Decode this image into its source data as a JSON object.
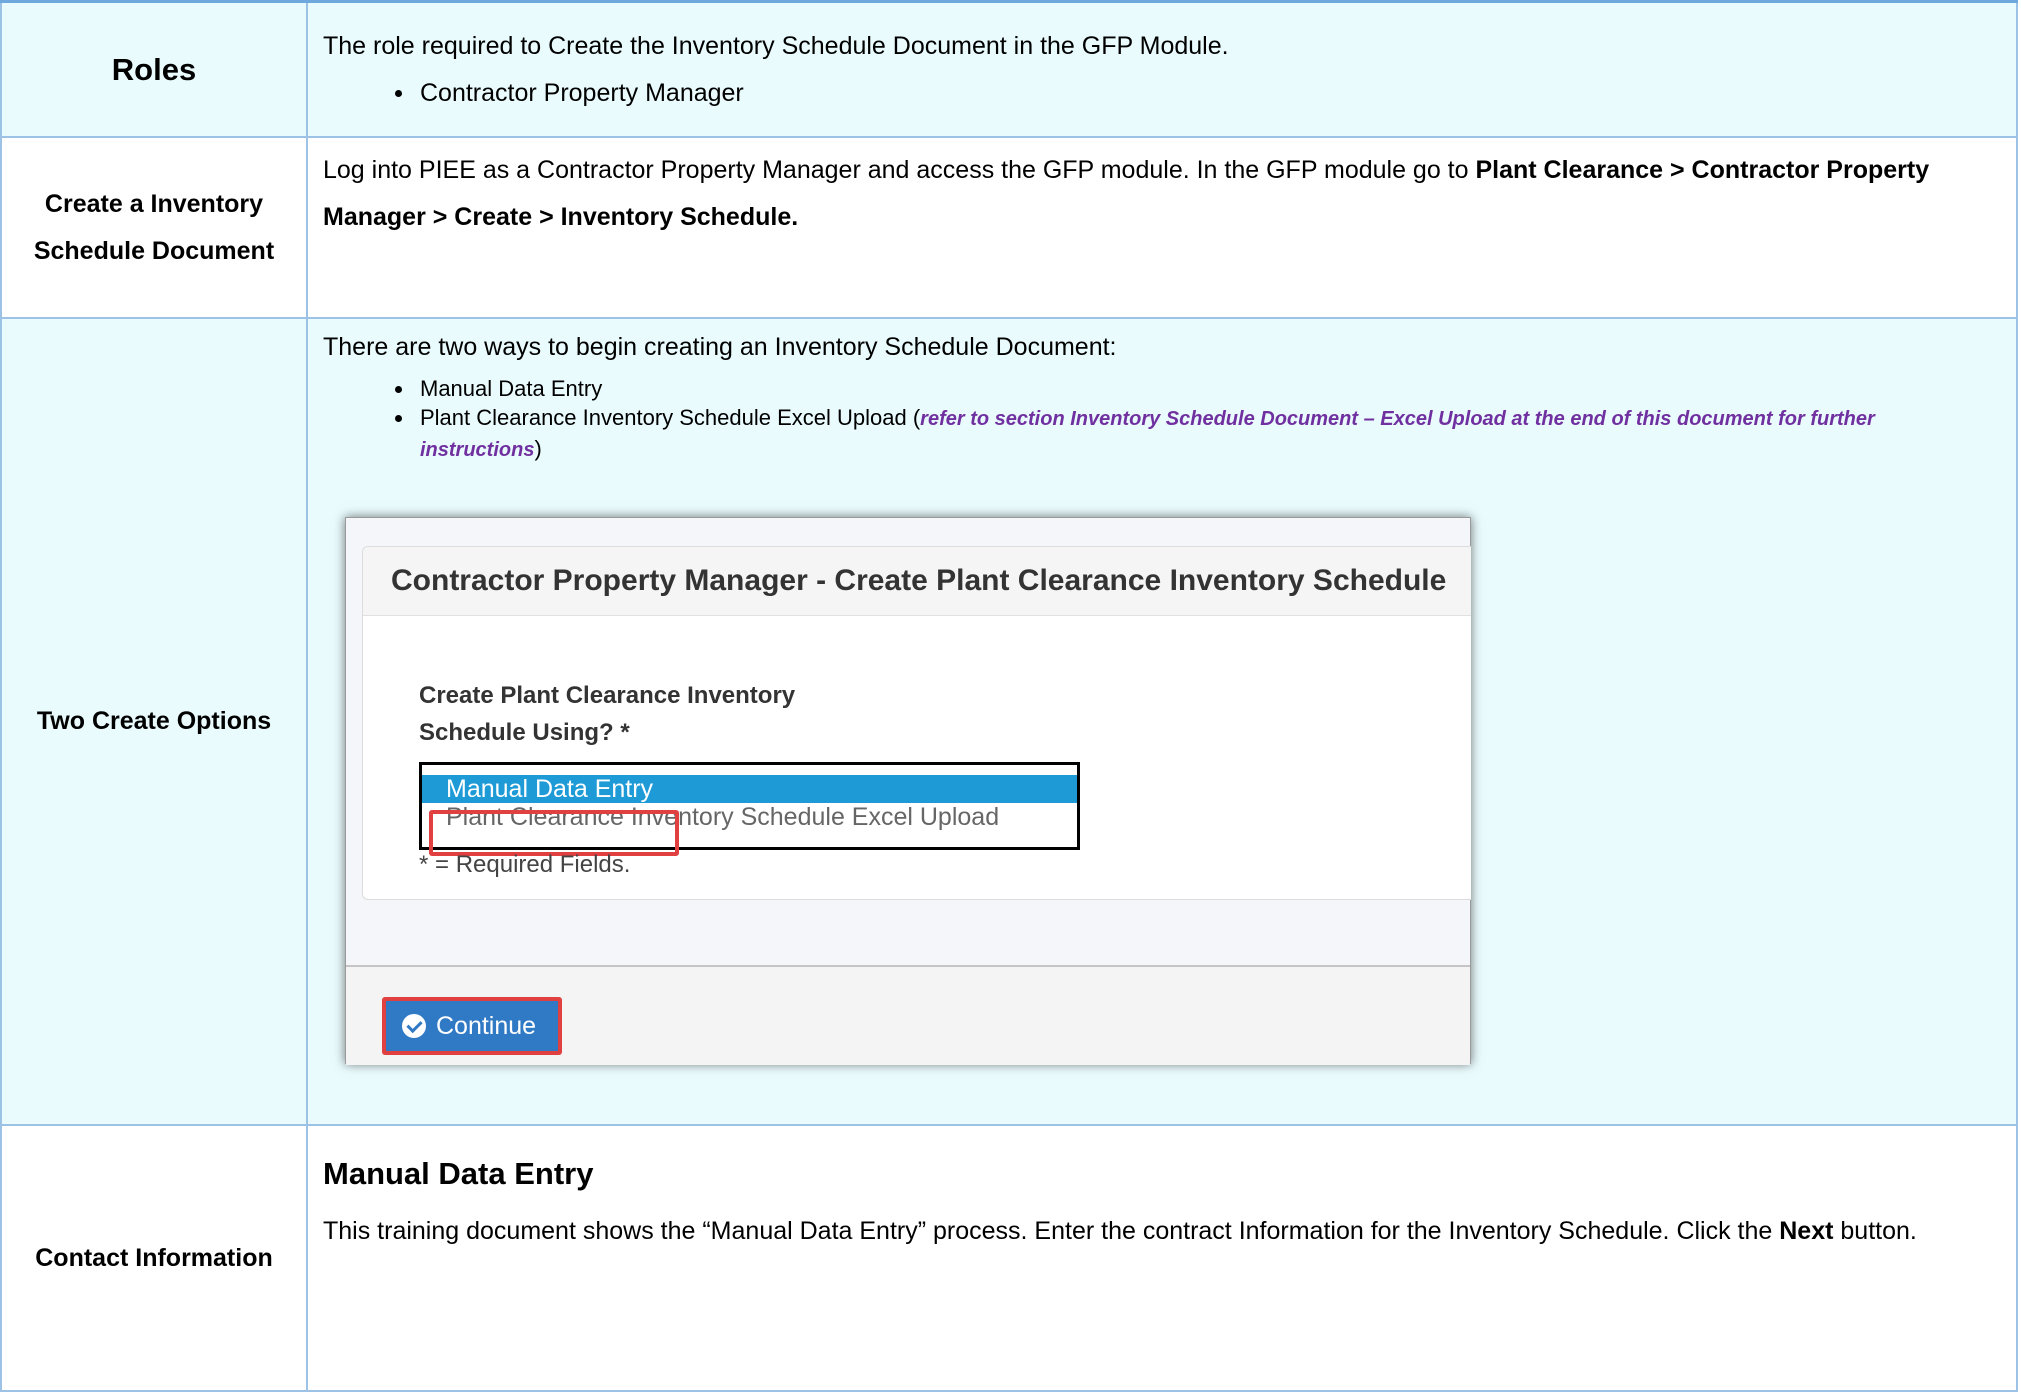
{
  "rows": {
    "roles": {
      "label": "Roles",
      "text": "The role required to Create the Inventory Schedule Document in the GFP Module.",
      "bullets": [
        "Contractor Property Manager"
      ]
    },
    "create": {
      "label": "Create a Inventory Schedule Document",
      "text_plain": "Log into PIEE as a Contractor Property Manager and access the GFP module. In the GFP module go to ",
      "text_bold": "Plant Clearance > Contractor Property Manager > Create > Inventory Schedule."
    },
    "options": {
      "label": "Two Create Options",
      "intro": "There are two ways to begin creating an Inventory Schedule Document:",
      "bullet_1": "Manual Data Entry",
      "bullet_2_plain": "Plant Clearance Inventory Schedule Excel Upload (",
      "bullet_2_ref": "refer to section Inventory Schedule Document – Excel Upload at the end of this document for further instructions",
      "bullet_2_close": ")",
      "screenshot": {
        "heading": "Contractor Property Manager - Create Plant Clearance Inventory Schedule",
        "question": "Create Plant Clearance Inventory Schedule Using? *",
        "options": [
          "Manual Data Entry",
          "Plant Clearance Inventory Schedule Excel Upload"
        ],
        "selected": "Manual Data Entry",
        "required_note": "* = Required Fields.",
        "continue_label": "Continue",
        "continue_icon": "check-circle-icon"
      }
    },
    "contact": {
      "label": "Contact Information",
      "heading": "Manual Data Entry",
      "text_plain": "This training document shows the “Manual Data Entry” process. Enter the contract Information for the Inventory Schedule. Click the ",
      "text_bold": "Next",
      "text_end": " button."
    }
  },
  "colors": {
    "border": "#9cc3e6",
    "row_tint": "#e9fbfd",
    "reference": "#7030a0",
    "highlight": "#e04040",
    "selected_option": "#1e9bd7",
    "button": "#3079c5"
  }
}
